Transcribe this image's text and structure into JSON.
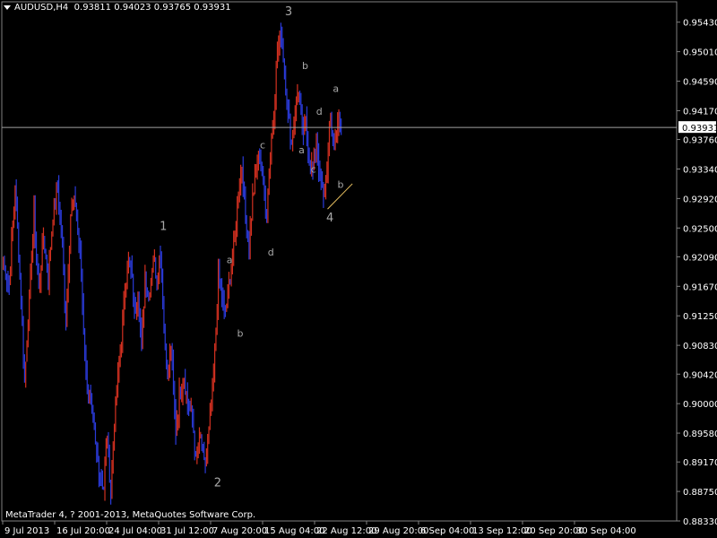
{
  "window": {
    "symbol_timeframe": "AUDUSD,H4",
    "ohlc": "0.93811 0.94023 0.93765 0.93931",
    "copyright": "MetaTrader 4, ? 2001-2013, MetaQuotes Software Corp."
  },
  "colors": {
    "background": "#000000",
    "bull": "#d23020",
    "bear": "#2a3ad8",
    "grid": "#808080",
    "bid_line": "#a0a0a0",
    "wave_label": "#a8a8a8",
    "trendline": "#e8c060",
    "price_box_bg": "#ffffff",
    "price_box_fg": "#000000"
  },
  "chart_data": {
    "type": "line",
    "title": "",
    "ylim": [
      0.8833,
      0.9572
    ],
    "y_ticks": [
      "0.95430",
      "0.95010",
      "0.94590",
      "0.94170",
      "0.93760",
      "0.93340",
      "0.92920",
      "0.92500",
      "0.92090",
      "0.91670",
      "0.91250",
      "0.90830",
      "0.90420",
      "0.90000",
      "0.89580",
      "0.89170",
      "0.88750",
      "0.88330"
    ],
    "x_ticks": [
      "9 Jul 2013",
      "16 Jul 20:00",
      "24 Jul 04:00",
      "31 Jul 12:00",
      "7 Aug 20:00",
      "15 Aug 04:00",
      "22 Aug 12:00",
      "29 Aug 20:00",
      "6 Sep 04:00",
      "13 Sep 12:00",
      "20 Sep 20:00",
      "30 Sep 04:00"
    ],
    "current_price": "0.93931",
    "bars_per_tick": 44,
    "series": [
      {
        "price_path": [
          [
            0,
            0.92
          ],
          [
            5,
            0.917
          ],
          [
            10,
            0.931
          ],
          [
            15,
            0.915
          ],
          [
            18,
            0.903
          ],
          [
            22,
            0.915
          ],
          [
            26,
            0.927
          ],
          [
            30,
            0.916
          ],
          [
            34,
            0.924
          ],
          [
            38,
            0.918
          ],
          [
            42,
            0.927
          ],
          [
            46,
            0.931
          ],
          [
            50,
            0.922
          ],
          [
            53,
            0.912
          ],
          [
            57,
            0.927
          ],
          [
            61,
            0.929
          ],
          [
            65,
            0.921
          ],
          [
            70,
            0.904
          ],
          [
            74,
            0.9
          ],
          [
            78,
            0.894
          ],
          [
            82,
            0.89
          ],
          [
            85,
            0.888
          ],
          [
            88,
            0.896
          ],
          [
            91,
            0.887
          ],
          [
            94,
            0.898
          ],
          [
            98,
            0.905
          ],
          [
            102,
            0.914
          ],
          [
            105,
            0.92
          ],
          [
            108,
            0.919
          ],
          [
            111,
            0.913
          ],
          [
            114,
            0.916
          ],
          [
            117,
            0.908
          ],
          [
            120,
            0.918
          ],
          [
            123,
            0.915
          ],
          [
            127,
            0.921
          ],
          [
            130,
            0.918
          ],
          [
            133,
            0.922
          ],
          [
            136,
            0.911
          ],
          [
            139,
            0.904
          ],
          [
            142,
            0.908
          ],
          [
            146,
            0.896
          ],
          [
            149,
            0.901
          ],
          [
            153,
            0.904
          ],
          [
            156,
            0.9
          ],
          [
            160,
            0.898
          ],
          [
            163,
            0.892
          ],
          [
            167,
            0.895
          ],
          [
            170,
            0.891
          ],
          [
            173,
            0.894
          ],
          [
            176,
            0.899
          ],
          [
            179,
            0.907
          ],
          [
            182,
            0.918
          ],
          [
            184,
            0.917
          ],
          [
            187,
            0.913
          ],
          [
            190,
            0.915
          ],
          [
            193,
            0.92
          ],
          [
            196,
            0.923
          ],
          [
            199,
            0.93
          ],
          [
            202,
            0.934
          ],
          [
            205,
            0.926
          ],
          [
            208,
            0.923
          ],
          [
            211,
            0.929
          ],
          [
            214,
            0.933
          ],
          [
            217,
            0.936
          ],
          [
            220,
            0.931
          ],
          [
            223,
            0.927
          ],
          [
            226,
            0.936
          ],
          [
            229,
            0.942
          ],
          [
            232,
            0.95
          ],
          [
            235,
            0.953
          ],
          [
            238,
            0.948
          ],
          [
            241,
            0.941
          ],
          [
            244,
            0.937
          ],
          [
            247,
            0.942
          ],
          [
            250,
            0.945
          ],
          [
            253,
            0.938
          ],
          [
            256,
            0.94
          ],
          [
            259,
            0.935
          ],
          [
            262,
            0.933
          ],
          [
            265,
            0.938
          ],
          [
            268,
            0.932
          ],
          [
            271,
            0.929
          ],
          [
            274,
            0.934
          ],
          [
            277,
            0.941
          ],
          [
            280,
            0.936
          ],
          [
            283,
            0.94
          ],
          [
            286,
            0.9393
          ]
        ]
      }
    ],
    "annotations": [
      {
        "text": "1",
        "bar": 136,
        "price": 0.9247
      },
      {
        "text": "2",
        "bar": 182,
        "price": 0.8882
      },
      {
        "text": "3",
        "bar": 242,
        "price": 0.9553
      },
      {
        "text": "4",
        "bar": 277,
        "price": 0.9259
      },
      {
        "text": "a",
        "bar": 192,
        "price": 0.92
      },
      {
        "text": "b",
        "bar": 201,
        "price": 0.9095
      },
      {
        "text": "c",
        "bar": 220,
        "price": 0.9363
      },
      {
        "text": "d",
        "bar": 227,
        "price": 0.9211
      },
      {
        "text": "b",
        "bar": 256,
        "price": 0.9476
      },
      {
        "text": "a",
        "bar": 253,
        "price": 0.9356
      },
      {
        "text": "d",
        "bar": 268,
        "price": 0.9411
      },
      {
        "text": "c",
        "bar": 263,
        "price": 0.9329
      },
      {
        "text": "a",
        "bar": 282,
        "price": 0.9444
      },
      {
        "text": "b",
        "bar": 286,
        "price": 0.9307
      }
    ],
    "trendline": {
      "from": [
        275,
        0.9277
      ],
      "to": [
        296,
        0.9313
      ]
    }
  }
}
